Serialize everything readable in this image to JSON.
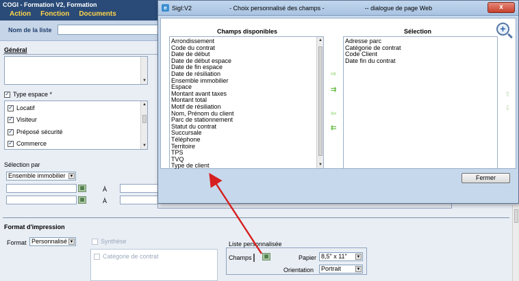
{
  "app": {
    "title": "COGI - Formation V2, Formation",
    "menu": [
      "Action",
      "Fonction",
      "Documents"
    ]
  },
  "list_name": {
    "label": "Nom de la liste"
  },
  "tabs": {
    "general": "Général"
  },
  "type_espace": {
    "label": "Type espace *",
    "items": [
      "Locatif",
      "Visiteur",
      "Préposé sécurité",
      "Commerce"
    ]
  },
  "selection_par": {
    "label": "Sélection par",
    "selected": "Ensemble immobilier",
    "a_label": "À"
  },
  "format_impression": {
    "section_title": "Format d'impression",
    "format_label": "Format",
    "format_value": "Personnalisé",
    "synthese_label": "Synthèse",
    "categorie_label": "Catégorie de contrat",
    "liste_perso_label": "Liste personnalisée",
    "champs_label": "Champs",
    "papier_label": "Papier",
    "papier_value": "8,5\" x 11\"",
    "orientation_label": "Orientation",
    "orientation_value": "Portrait"
  },
  "dialog": {
    "app_name": "SigI:V2",
    "title": "- Choix personnalisé des champs -",
    "title_suffix": "-- dialogue de page Web",
    "close_x": "x",
    "available_header": "Champs disponibles",
    "selection_header": "Sélection",
    "available_fields": [
      "Arrondissement",
      "Code du contrat",
      "Date de début",
      "Date de début espace",
      "Date de fin espace",
      "Date de résiliation",
      "Ensemble immobilier",
      "Espace",
      "Montant avant taxes",
      "Montant total",
      "Motif de résiliation",
      "Nom, Prénom du client",
      "Parc de stationnement",
      "Statut du contrat",
      "Succursale",
      "Téléphone",
      "Territoire",
      "TPS",
      "TVQ",
      "Type de client"
    ],
    "selected_fields": [
      "Adresse parc",
      "Catégorie de contrat",
      "Code Client",
      "Date fin du contrat"
    ],
    "close_button": "Fermer"
  }
}
